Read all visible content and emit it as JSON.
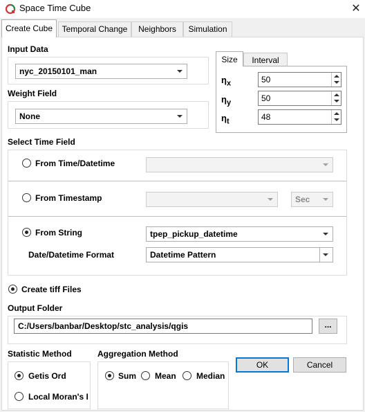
{
  "window": {
    "title": "Space Time Cube",
    "close_glyph": "✕"
  },
  "tabs": [
    "Create Cube",
    "Temporal Change",
    "Neighbors",
    "Simulation"
  ],
  "input_data": {
    "label": "Input Data",
    "value": "nyc_20150101_man"
  },
  "weight_field": {
    "label": "Weight Field",
    "value": "None"
  },
  "size_panel": {
    "tabs": [
      "Size",
      "Interval"
    ],
    "fields": [
      {
        "symbol": "η",
        "sub": "x",
        "value": "50"
      },
      {
        "symbol": "η",
        "sub": "y",
        "value": "50"
      },
      {
        "symbol": "η",
        "sub": "t",
        "value": "48"
      }
    ]
  },
  "time_field": {
    "label": "Select Time Field",
    "from_time": {
      "label": "From Time/Datetime",
      "value": ""
    },
    "from_timestamp": {
      "label": "From Timestamp",
      "value": "",
      "unit": "Sec"
    },
    "from_string": {
      "label": "From String",
      "value": "tpep_pickup_datetime"
    },
    "date_format": {
      "label": "Date/Datetime Format",
      "value": "Datetime Pattern"
    }
  },
  "create_tiff": {
    "label": "Create tiff Files"
  },
  "output_folder": {
    "label": "Output Folder",
    "value": "C:/Users/banbar/Desktop/stc_analysis/qgis",
    "browse": "..."
  },
  "statistic_method": {
    "label": "Statistic Method",
    "options": [
      "Getis Ord",
      "Local Moran's I"
    ]
  },
  "aggregation_method": {
    "label": "Aggregation Method",
    "options": [
      "Sum",
      "Mean",
      "Median"
    ]
  },
  "buttons": {
    "ok": "OK",
    "cancel": "Cancel"
  },
  "colors": {
    "accent": "#0078d7",
    "icon_red": "#d13438",
    "icon_green": "#2e8b57"
  },
  "icons": {
    "app": "qgis-plugin-icon",
    "close": "close-icon"
  }
}
